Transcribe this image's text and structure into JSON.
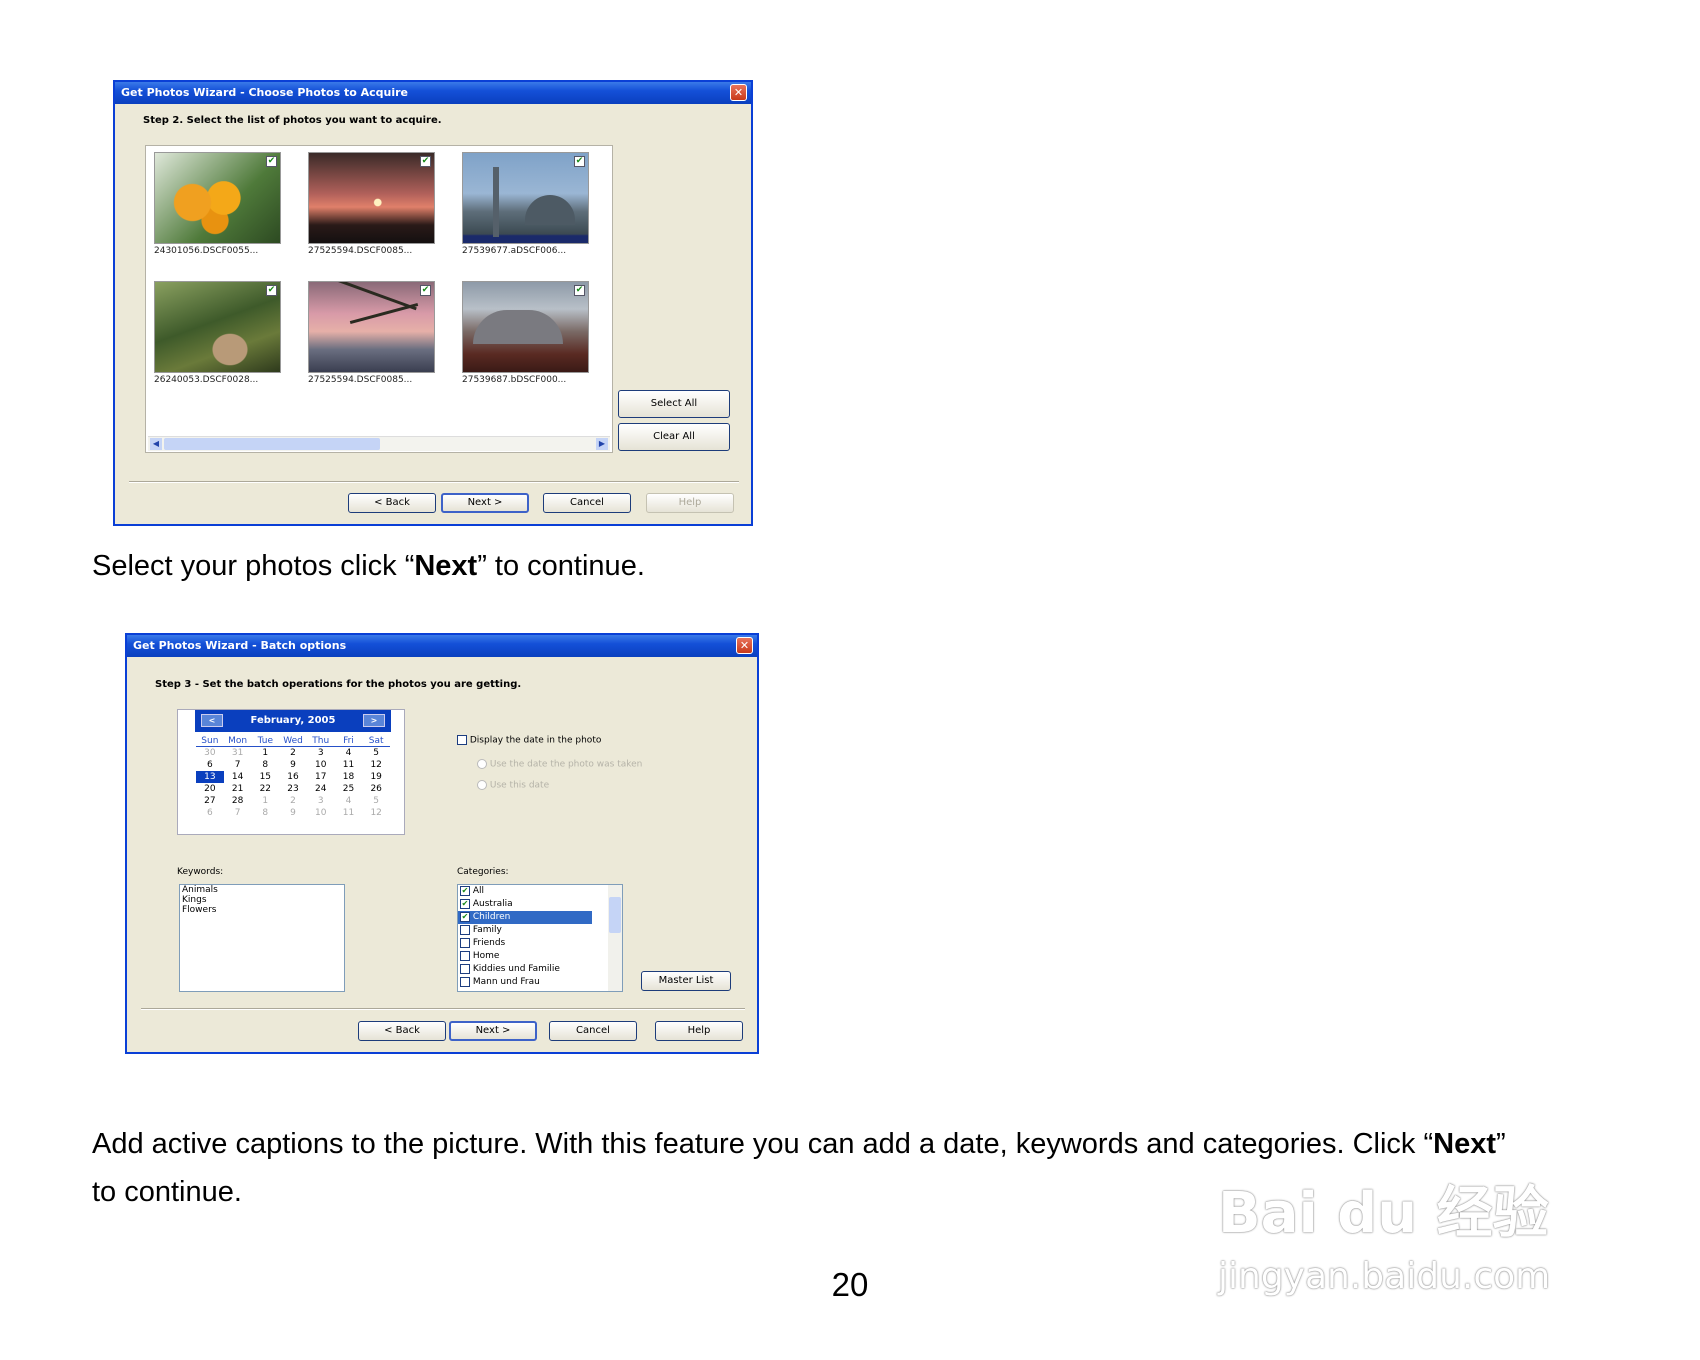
{
  "dialog1": {
    "title": "Get Photos Wizard - Choose Photos to Acquire",
    "step": "Step 2. Select the list of photos you want to acquire.",
    "photos": [
      {
        "caption": "24301056.DSCF0055..."
      },
      {
        "caption": "27525594.DSCF0085..."
      },
      {
        "caption": "27539677.aDSCF006..."
      },
      {
        "caption": "26240053.DSCF0028..."
      },
      {
        "caption": "27525594.DSCF0085..."
      },
      {
        "caption": "27539687.bDSCF000..."
      }
    ],
    "select_all": "Select All",
    "clear_all": "Clear All",
    "back": "< Back",
    "next": "Next >",
    "cancel": "Cancel",
    "help": "Help"
  },
  "caption1": {
    "before": "Select your photos click “",
    "bold": "Next",
    "after": "” to continue."
  },
  "dialog2": {
    "title": "Get Photos Wizard - Batch options",
    "step": "Step 3 - Set the batch operations for the photos you are getting.",
    "calendar": {
      "month": "February, 2005",
      "prev": "<",
      "next": ">",
      "weekdays": [
        "Sun",
        "Mon",
        "Tue",
        "Wed",
        "Thu",
        "Fri",
        "Sat"
      ],
      "weeks": [
        [
          "30",
          "31",
          "1",
          "2",
          "3",
          "4",
          "5"
        ],
        [
          "6",
          "7",
          "8",
          "9",
          "10",
          "11",
          "12"
        ],
        [
          "13",
          "14",
          "15",
          "16",
          "17",
          "18",
          "19"
        ],
        [
          "20",
          "21",
          "22",
          "23",
          "24",
          "25",
          "26"
        ],
        [
          "27",
          "28",
          "1",
          "2",
          "3",
          "4",
          "5"
        ],
        [
          "6",
          "7",
          "8",
          "9",
          "10",
          "11",
          "12"
        ]
      ],
      "today": "13"
    },
    "display_date": "Display the date in the photo",
    "use_taken": "Use the date the photo was taken",
    "use_this": "Use this date",
    "keywords_label": "Keywords:",
    "keywords": [
      "Animals",
      "Kings",
      "Flowers"
    ],
    "categories_label": "Categories:",
    "categories": [
      {
        "label": "All",
        "checked": true
      },
      {
        "label": "Australia",
        "checked": true
      },
      {
        "label": "Children",
        "checked": true
      },
      {
        "label": "Family",
        "checked": false
      },
      {
        "label": "Friends",
        "checked": false
      },
      {
        "label": "Home",
        "checked": false
      },
      {
        "label": "Kiddies und Familie",
        "checked": false
      },
      {
        "label": "Mann und Frau",
        "checked": false
      }
    ],
    "master_list": "Master List",
    "back": "< Back",
    "next": "Next >",
    "cancel": "Cancel",
    "help": "Help"
  },
  "caption2": {
    "before": "Add active captions to the picture. With this feature you can add a date, keywords and categories. Click “",
    "bold": "Next",
    "after": "”",
    "line2": "to continue."
  },
  "page_number": "20",
  "watermark": {
    "logo": "Bai du 经验",
    "url": "jingyan.baidu.com"
  }
}
